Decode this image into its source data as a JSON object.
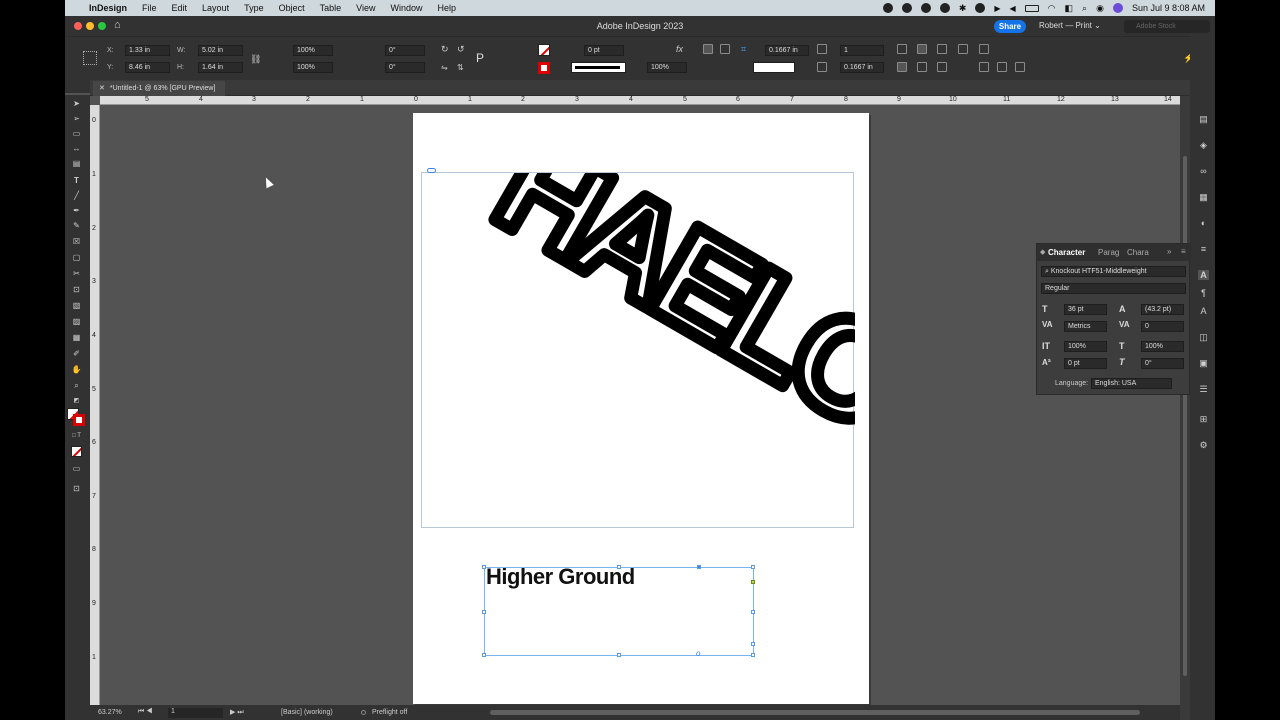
{
  "menubar": {
    "app": "InDesign",
    "items": [
      "File",
      "Edit",
      "Layout",
      "Type",
      "Object",
      "Table",
      "View",
      "Window",
      "Help"
    ],
    "clock": "Sun Jul 9  8:08 AM"
  },
  "window": {
    "title": "Adobe InDesign 2023",
    "share_label": "Share",
    "workspace": "Robert — Print",
    "search_placeholder": "Adobe Stock"
  },
  "control": {
    "x_label": "X:",
    "x_value": "1.33 in",
    "y_label": "Y:",
    "y_value": "8.46 in",
    "w_label": "W:",
    "w_value": "5.02 in",
    "h_label": "H:",
    "h_value": "1.64 in",
    "scale_x": "100%",
    "scale_y": "100%",
    "rotate": "0°",
    "shear": "0°",
    "stroke_weight": "0 pt",
    "opacity": "100%",
    "offset_a": "0.1667 in",
    "offset_b": "0.1667 in",
    "columns": "1"
  },
  "doc_tab": {
    "label": "*Untitled-1 @ 63% [GPU Preview]"
  },
  "ruler": {
    "h_ticks": [
      "5",
      "4",
      "3",
      "2",
      "1",
      "0",
      "1",
      "2",
      "3",
      "4",
      "5",
      "6",
      "7",
      "8",
      "9",
      "10",
      "11",
      "12",
      "13",
      "14"
    ],
    "v_ticks": [
      "0",
      "1",
      "2",
      "3",
      "4",
      "5",
      "6",
      "7",
      "8",
      "9",
      "1"
    ]
  },
  "artwork": {
    "text": "HAELOS"
  },
  "text_frame": {
    "text": "Higher Ground"
  },
  "character_panel": {
    "tabs": [
      "Character",
      "Parag",
      "Chara"
    ],
    "font_family": "Knockout HTF51-Middleweight",
    "font_style": "Regular",
    "size": "36 pt",
    "leading": "(43.2 pt)",
    "kerning": "Metrics",
    "tracking": "0",
    "vscale": "100%",
    "hscale": "100%",
    "baseline": "0 pt",
    "skew": "0°",
    "language_label": "Language:",
    "language": "English: USA"
  },
  "status": {
    "zoom": "63.27%",
    "page": "1",
    "style": "[Basic] (working)",
    "preflight": "Preflight off"
  }
}
